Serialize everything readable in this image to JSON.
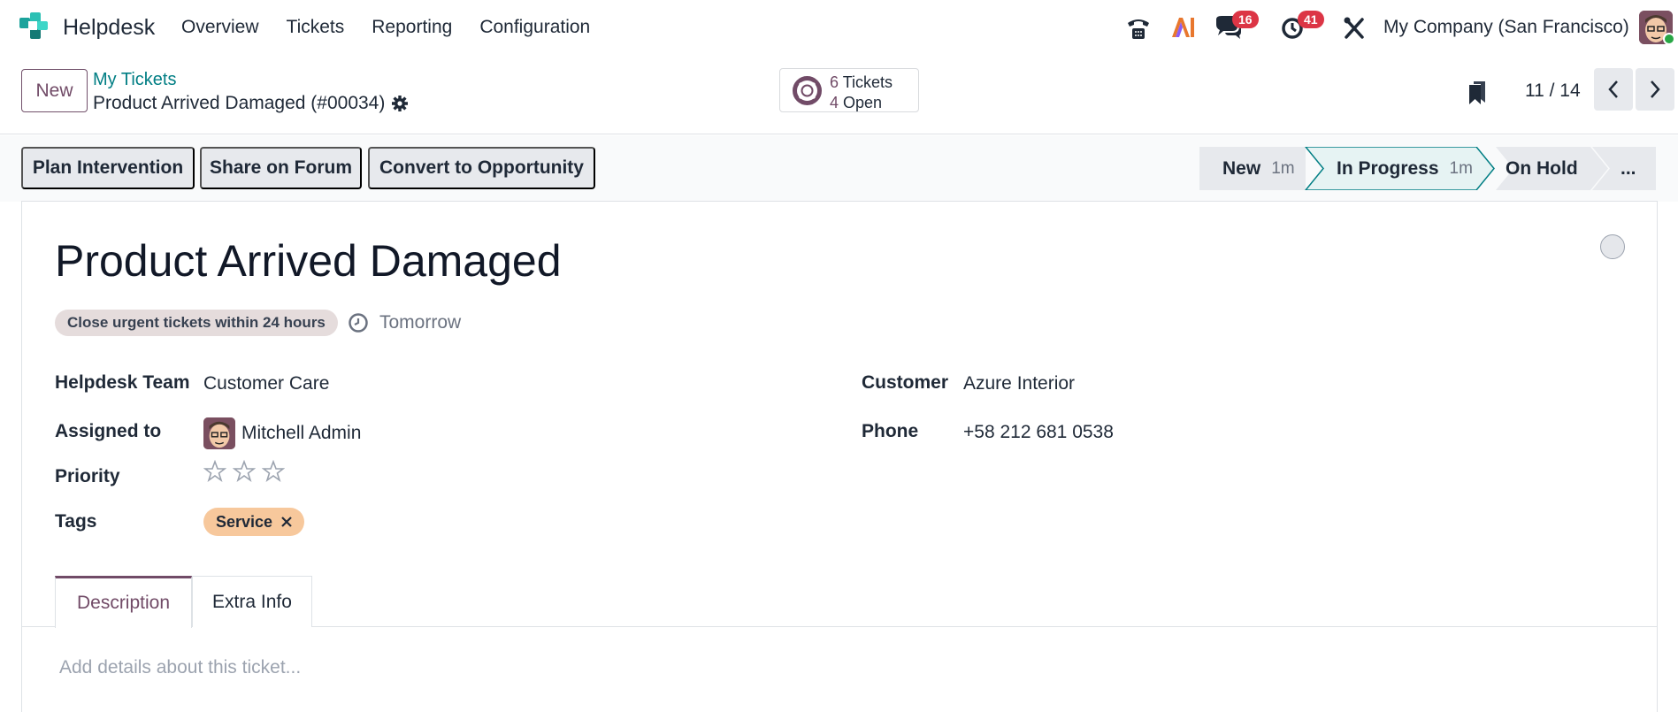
{
  "navbar": {
    "app_name": "Helpdesk",
    "menu": [
      "Overview",
      "Tickets",
      "Reporting",
      "Configuration"
    ],
    "messages_count": "16",
    "activities_count": "41",
    "company": "My Company (San Francisco)"
  },
  "control": {
    "new_label": "New",
    "breadcrumb_parent": "My Tickets",
    "breadcrumb_current": "Product Arrived Damaged (#00034)",
    "stat_tickets_count": "6",
    "stat_tickets_label": "Tickets",
    "stat_open_count": "4",
    "stat_open_label": "Open",
    "pager": "11 / 14"
  },
  "actions": {
    "plan_intervention": "Plan Intervention",
    "share_forum": "Share on Forum",
    "convert_opportunity": "Convert to Opportunity"
  },
  "statusbar": {
    "stages": [
      {
        "label": "New",
        "duration": "1m"
      },
      {
        "label": "In Progress",
        "duration": "1m"
      },
      {
        "label": "On Hold",
        "duration": ""
      },
      {
        "label": "...",
        "duration": ""
      }
    ]
  },
  "form": {
    "title": "Product Arrived Damaged",
    "sla_name": "Close urgent tickets within 24 hours",
    "sla_deadline": "Tomorrow",
    "team_label": "Helpdesk Team",
    "team_value": "Customer Care",
    "assigned_label": "Assigned to",
    "assigned_value": "Mitchell Admin",
    "priority_label": "Priority",
    "priority_value": 0,
    "tags_label": "Tags",
    "tag": "Service",
    "customer_label": "Customer",
    "customer_value": "Azure Interior",
    "phone_label": "Phone",
    "phone_value": "+58 212 681 0538",
    "tabs": [
      "Description",
      "Extra Info"
    ],
    "description_placeholder": "Add details about this ticket..."
  },
  "colors": {
    "brand": "#714b67",
    "link": "#017e84",
    "badge": "#dc3545",
    "tag_bg": "#f7c89c",
    "active_stage_border": "#017e84"
  }
}
